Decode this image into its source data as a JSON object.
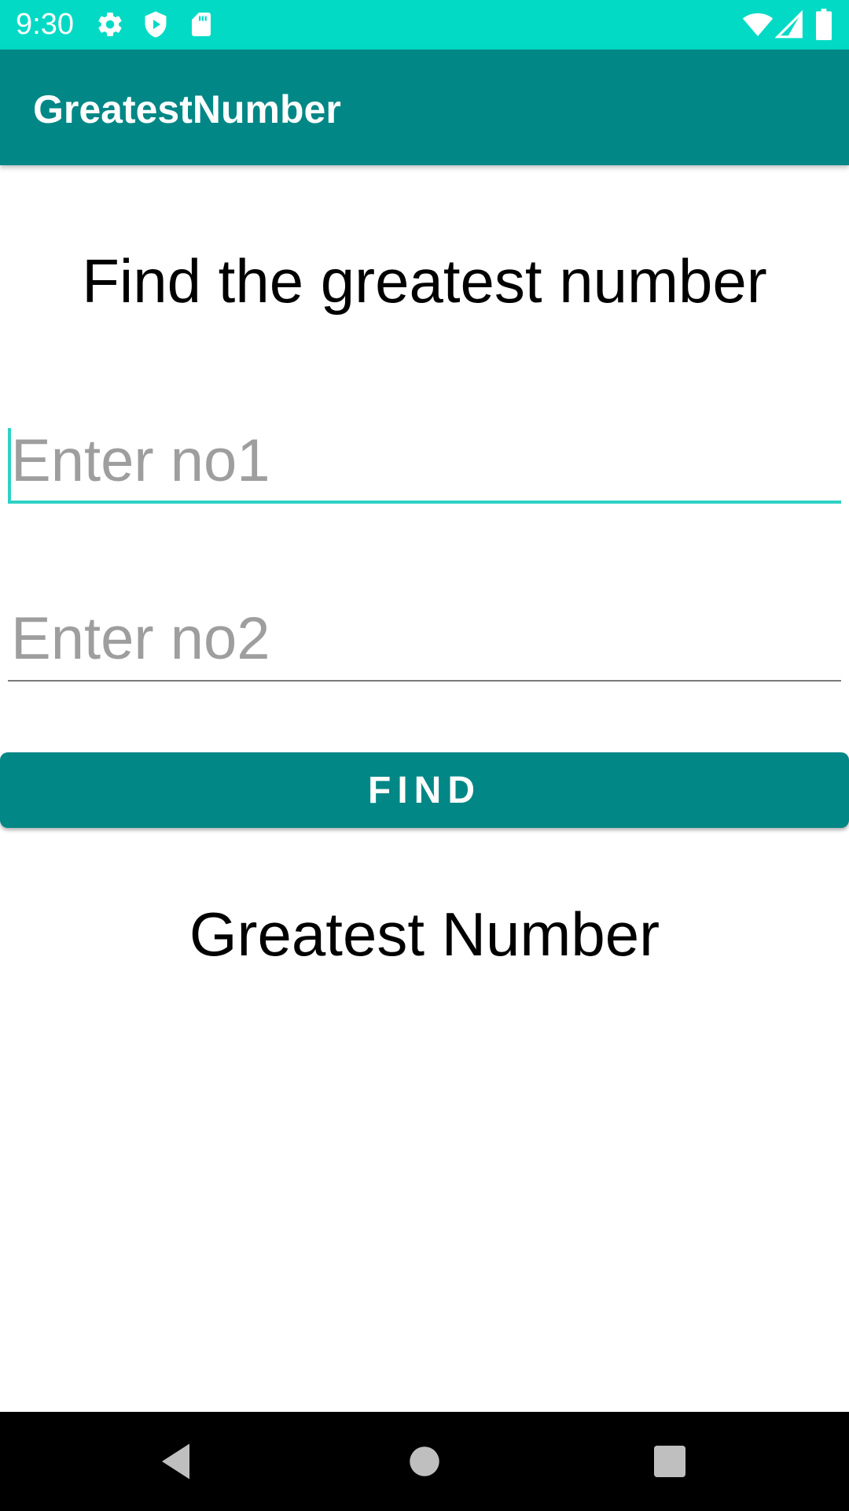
{
  "status_bar": {
    "time": "9:30",
    "background": "#03dac5",
    "left_icons": [
      "gear-icon",
      "shield-play-icon",
      "sd-card-icon"
    ],
    "right_icons": [
      "wifi-icon",
      "signal-icon",
      "battery-icon"
    ]
  },
  "app_bar": {
    "title": "GreatestNumber",
    "background": "#018786"
  },
  "main": {
    "heading": "Find the greatest number",
    "input1": {
      "value": "",
      "placeholder": "Enter no1",
      "focused": true
    },
    "input2": {
      "value": "",
      "placeholder": "Enter no2",
      "focused": false
    },
    "find_button_label": "FIND",
    "result_text": "Greatest Number",
    "accent_color": "#2fd1c4"
  },
  "nav_bar": {
    "buttons": [
      "back-icon",
      "home-icon",
      "recents-icon"
    ]
  }
}
